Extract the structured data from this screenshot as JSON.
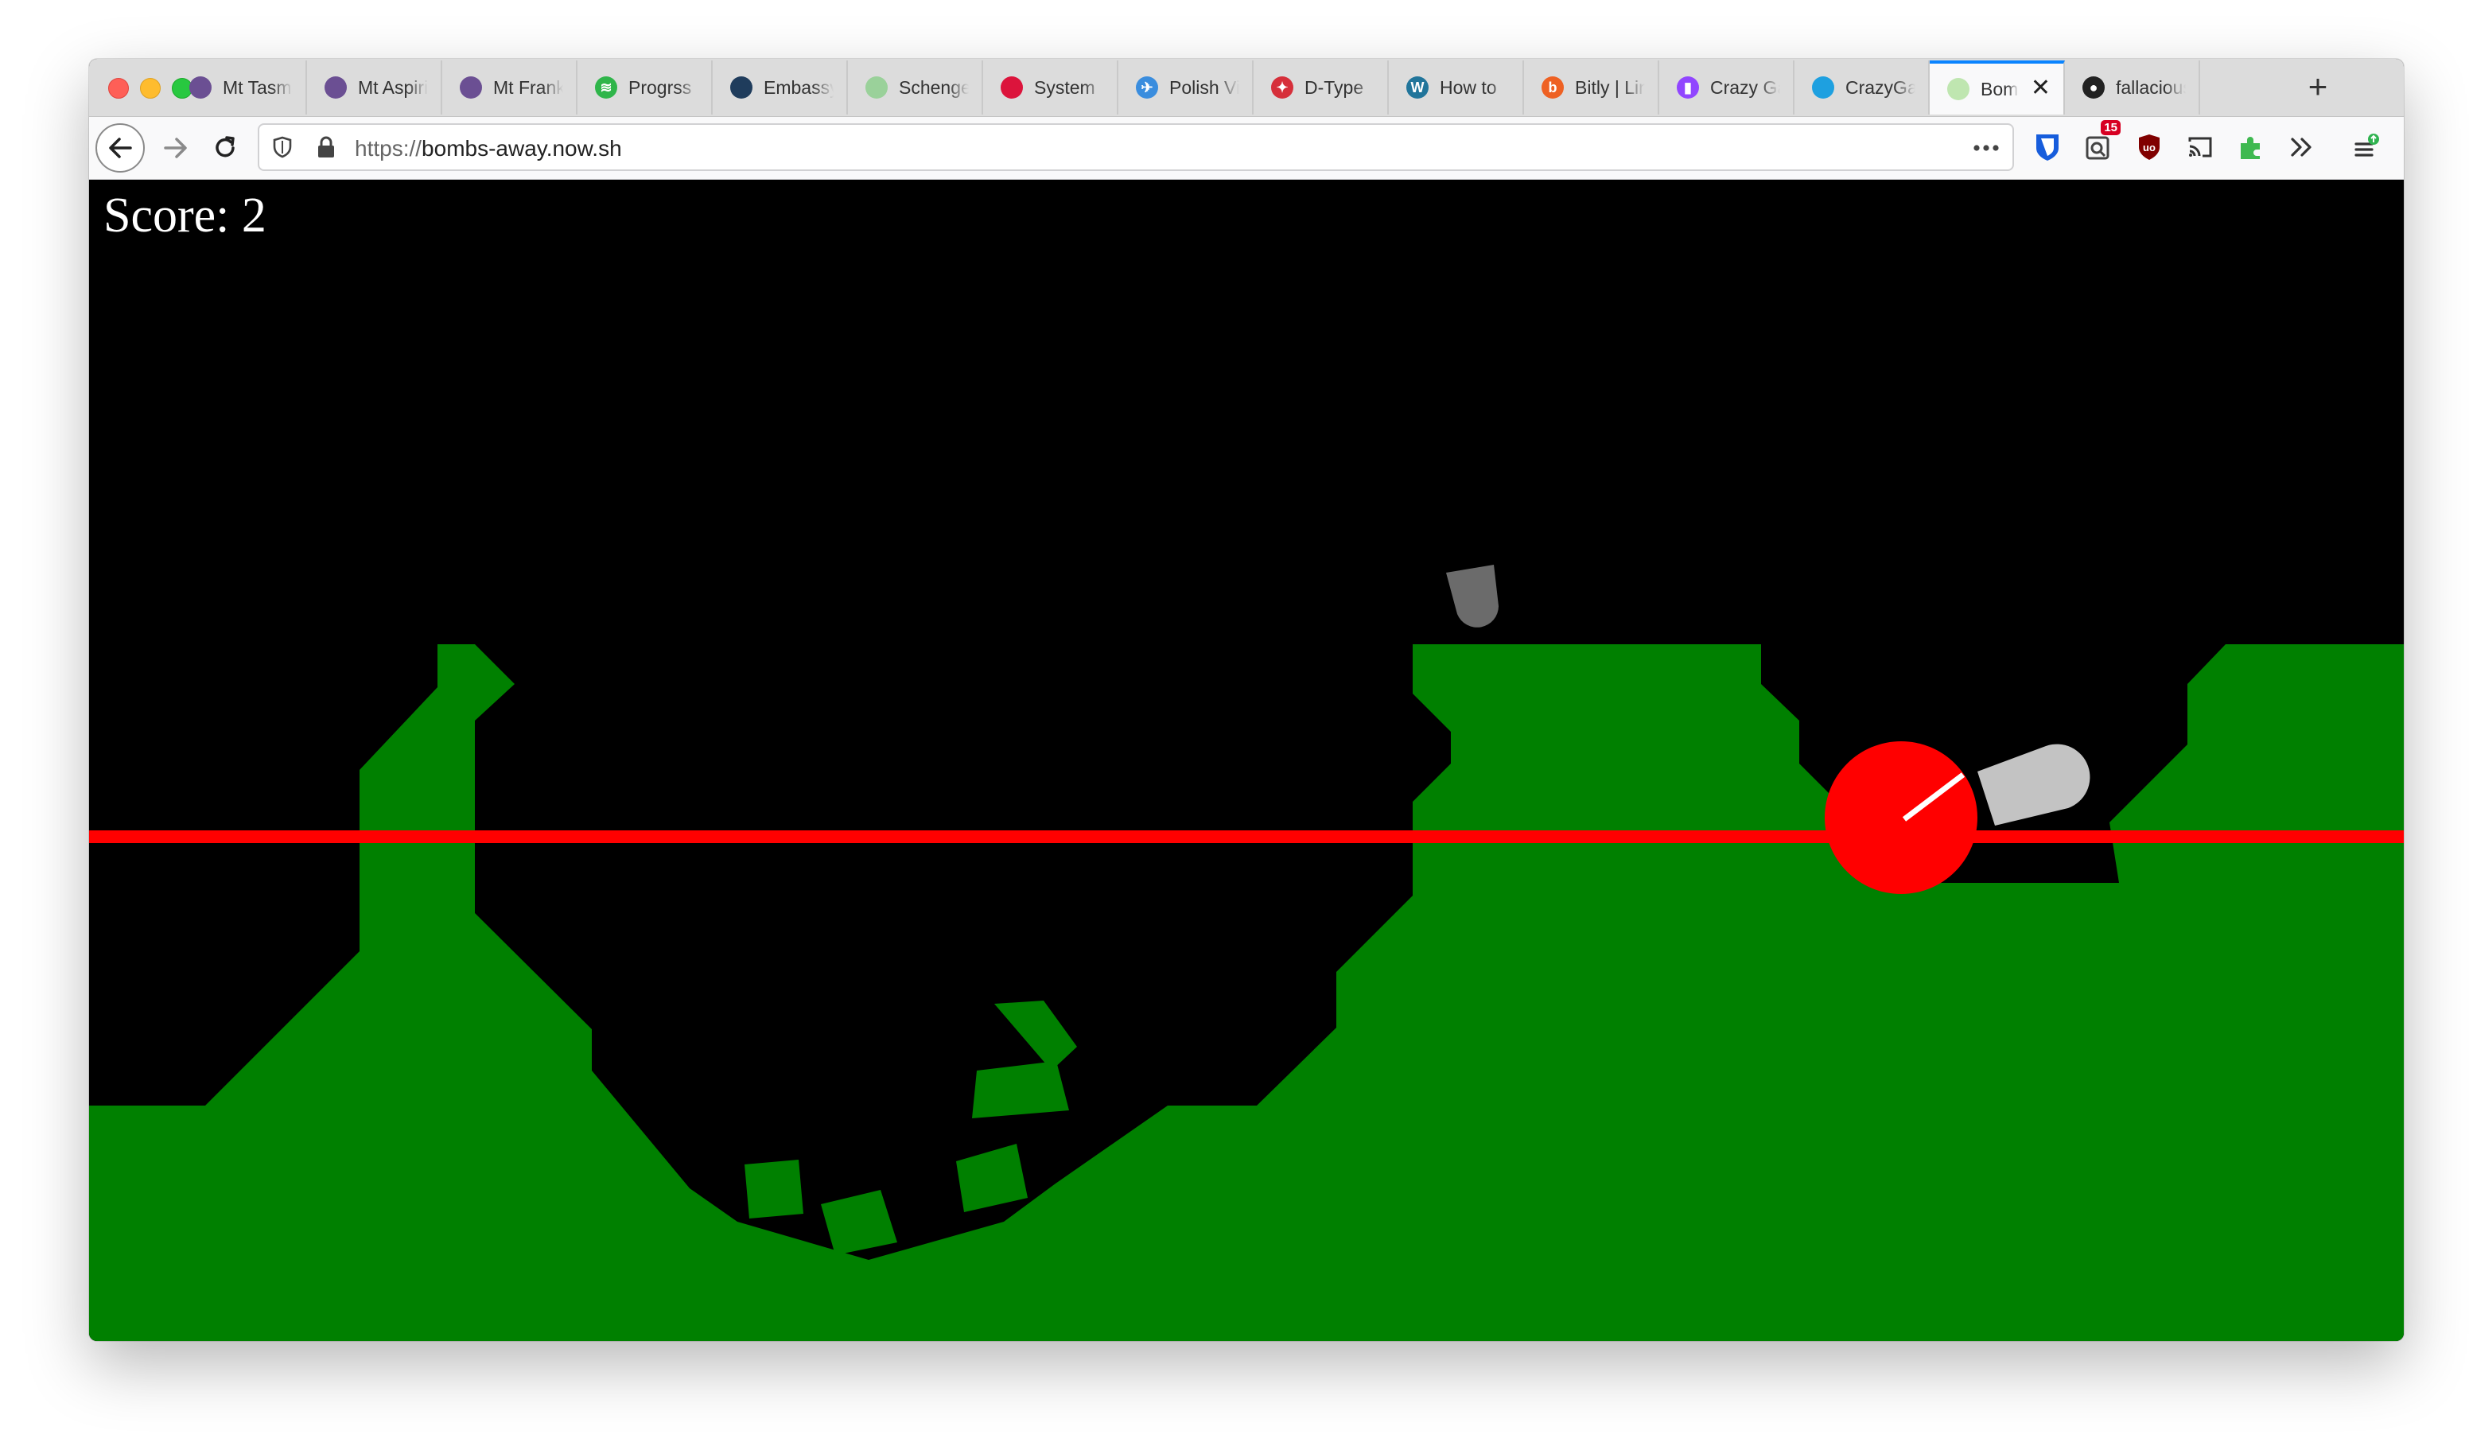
{
  "browser": {
    "tabs": [
      {
        "label": "Mt Tasman",
        "icon": "mountain-icon",
        "color": "#6b4f93",
        "glyph": ""
      },
      {
        "label": "Mt Aspiring",
        "icon": "mountain-icon",
        "color": "#6b4f93",
        "glyph": ""
      },
      {
        "label": "Mt Franklin",
        "icon": "mountain-icon",
        "color": "#6b4f93",
        "glyph": ""
      },
      {
        "label": "Progrss",
        "icon": "feed-icon",
        "color": "#2fb54a",
        "glyph": "≋"
      },
      {
        "label": "Embassy",
        "icon": "embassy-icon",
        "color": "#1f3c5c",
        "glyph": ""
      },
      {
        "label": "Schengen",
        "icon": "map-dots-icon",
        "color": "#9ad19a",
        "glyph": ""
      },
      {
        "label": "System",
        "icon": "poland-flag-icon",
        "color": "#dc143c",
        "glyph": ""
      },
      {
        "label": "Polish Visa",
        "icon": "plane-globe-icon",
        "color": "#3a8dde",
        "glyph": "✈"
      },
      {
        "label": "D-Type",
        "icon": "emblem-icon",
        "color": "#d62f3a",
        "glyph": "✦"
      },
      {
        "label": "How to",
        "icon": "wordpress-icon",
        "color": "#21759b",
        "glyph": "W"
      },
      {
        "label": "Bitly | Link",
        "icon": "bitly-icon",
        "color": "#ee6123",
        "glyph": "b"
      },
      {
        "label": "Crazy Games",
        "icon": "twitch-icon",
        "color": "#9146ff",
        "glyph": "▮"
      },
      {
        "label": "CrazyGames",
        "icon": "crazygames-icon",
        "color": "#1ea0e0",
        "glyph": ""
      },
      {
        "label": "Bombs Away",
        "icon": "page-icon",
        "color": "#bfe6b0",
        "glyph": "",
        "active": true
      },
      {
        "label": "fallacious",
        "icon": "github-icon",
        "color": "#222222",
        "glyph": "●"
      }
    ],
    "url_protocol": "https://",
    "url_host": "bombs-away.now.sh",
    "badge_count": "15"
  },
  "game": {
    "score_label": "Score: 2",
    "colors": {
      "sky": "#000000",
      "ground": "#008000",
      "player": "#ff0000",
      "bomb_dark": "#6b6b6b",
      "bomb_light": "#c3c3c3"
    }
  }
}
